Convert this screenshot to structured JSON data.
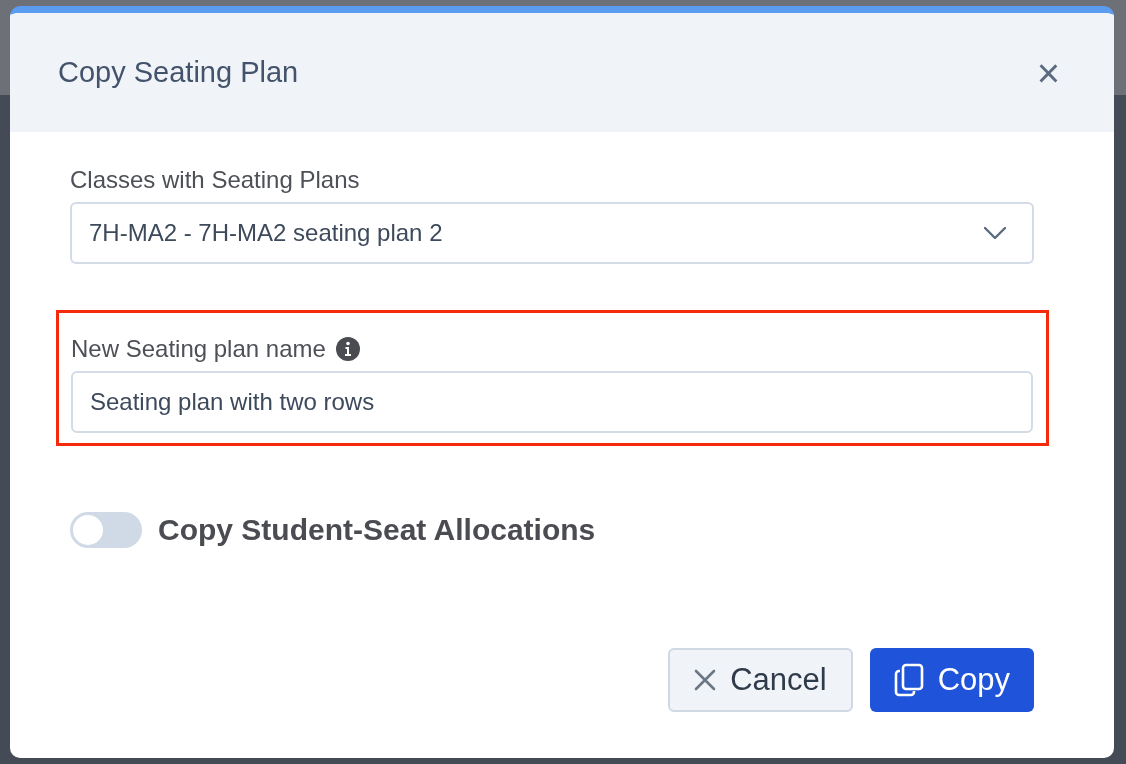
{
  "dialog": {
    "title": "Copy Seating Plan",
    "close_label": "×"
  },
  "class_select": {
    "label": "Classes with Seating Plans",
    "value": "7H-MA2 - 7H-MA2 seating plan 2"
  },
  "name_field": {
    "label": "New Seating plan name",
    "value": "Seating plan with two rows",
    "highlighted": true
  },
  "copy_allocations": {
    "label": "Copy Student-Seat Allocations",
    "on": false
  },
  "buttons": [
    {
      "kind": "cancel",
      "label": "Cancel"
    },
    {
      "kind": "primary",
      "label": "Copy"
    }
  ]
}
